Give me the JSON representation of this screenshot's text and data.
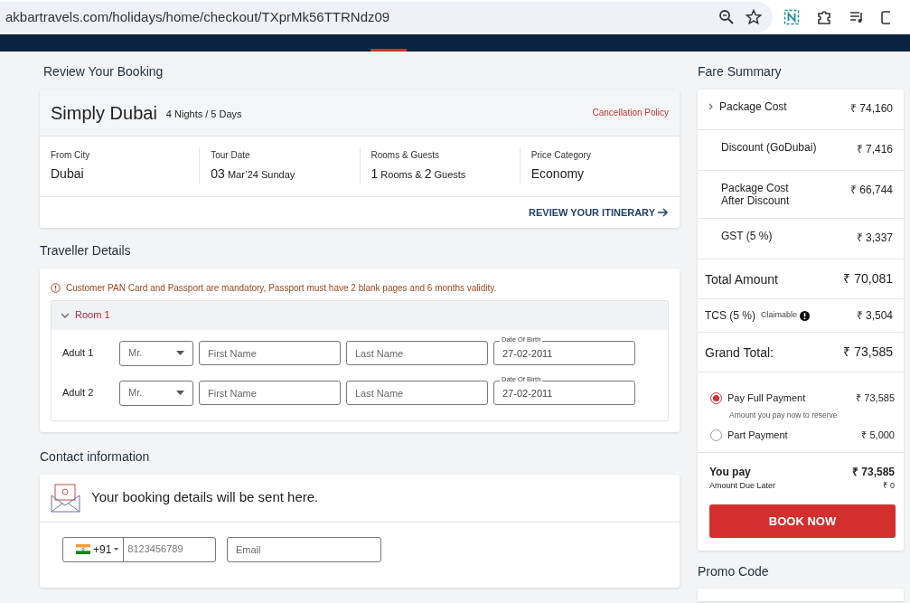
{
  "browser": {
    "url": "akbartravels.com/holidays/home/checkout/TXprMk56TTRNdz09"
  },
  "review": {
    "heading": "Review Your Booking",
    "title": "Simply Dubai",
    "duration": "4 Nights / 5 Days",
    "policy_link": "Cancellation Policy",
    "details": [
      {
        "label": "From City",
        "value": "Dubai",
        "emphasis": true
      },
      {
        "label": "Tour Date",
        "value": "**03** Mar’24 Sunday",
        "emphasis": false
      },
      {
        "label": "Rooms & Guests",
        "value": "**1** Rooms & **2** Guests",
        "emphasis": false
      },
      {
        "label": "Price Category",
        "value": "Economy",
        "emphasis": true
      }
    ],
    "itinerary_link": "REVIEW YOUR ITINERARY"
  },
  "traveller": {
    "heading": "Traveller Details",
    "notice": "Customer PAN Card and Passport are mandatory, Passport must have 2 blank pages and 6 months validity.",
    "rooms": [
      {
        "title": "Room 1",
        "expanded": true,
        "travellers": [
          {
            "label": "Adult 1",
            "salutation": "Mr.",
            "first_placeholder": "First Name",
            "last_placeholder": "Last Name",
            "dob_label": "Date Of Birth",
            "dob": "27-02-2011"
          },
          {
            "label": "Adult 2",
            "salutation": "Mr.",
            "first_placeholder": "First Name",
            "last_placeholder": "Last Name",
            "dob_label": "Date Of Birth",
            "dob": "27-02-2011"
          }
        ]
      }
    ]
  },
  "contact": {
    "heading": "Contact information",
    "message": "Your booking details will be sent here.",
    "country_code": "+91",
    "phone_placeholder": "8123456789",
    "email_placeholder": "Email"
  },
  "fare": {
    "heading": "Fare Summary",
    "rows": [
      {
        "kind": "item",
        "label": "Package Cost",
        "amount": "₹ 74,160",
        "expandable": true
      },
      {
        "kind": "item",
        "label": "Discount (GoDubai)",
        "amount": "₹ 7,416"
      },
      {
        "kind": "item",
        "label": "Package Cost\nAfter Discount",
        "amount": "₹ 66,744"
      },
      {
        "kind": "item",
        "label": "GST (5 %)",
        "amount": "₹ 3,337"
      },
      {
        "kind": "total",
        "label": "Total Amount",
        "amount": "₹ 70,081"
      },
      {
        "kind": "tcs",
        "label": "TCS  (5 %)",
        "note": "Claimable",
        "amount": "₹ 3,504"
      },
      {
        "kind": "total",
        "label": "Grand Total:",
        "amount": "₹ 73,585"
      }
    ],
    "payments": [
      {
        "label": "Pay Full Payment",
        "amount": "₹ 73,585",
        "note": "Amount you pay now to reserve",
        "selected": true
      },
      {
        "label": "Part Payment",
        "amount": "₹ 5,000",
        "selected": false
      }
    ],
    "you_pay_label": "You pay",
    "you_pay": "₹ 73,585",
    "due_label": "Amount Due Later",
    "due": "₹ 0",
    "button": "BOOK NOW"
  },
  "promo": {
    "heading": "Promo Code"
  }
}
